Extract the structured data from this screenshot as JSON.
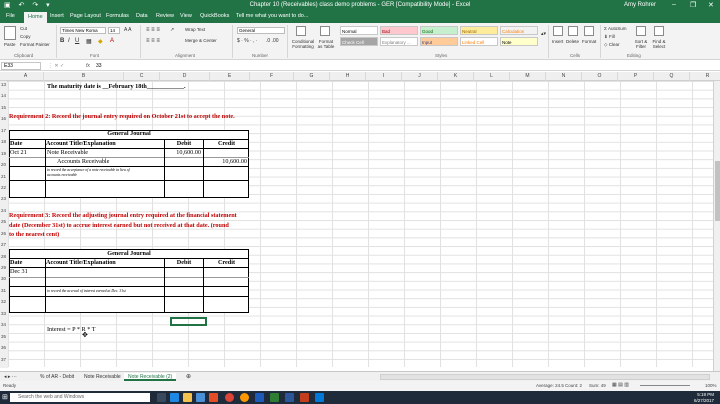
{
  "window": {
    "title": "Chapter 10 (Receivables) class demo problems - GER [Compatibility Mode] - Excel",
    "user": "Amy Rohrer"
  },
  "ribbon": {
    "tabs": [
      "File",
      "Home",
      "Insert",
      "Page Layout",
      "Formulas",
      "Data",
      "Review",
      "View",
      "QuickBooks",
      "Tell me what you want to do..."
    ],
    "active_tab": "Home",
    "font_name": "Times New Roma",
    "font_size": "14",
    "number_format": "General",
    "clipboard": {
      "cut": "Cut",
      "copy": "Copy",
      "format_painter": "Format Painter",
      "paste": "Paste"
    },
    "alignment": {
      "wrap": "Wrap Text",
      "merge": "Merge & Center"
    },
    "cond_format": "Conditional Formatting",
    "format_as_table": "Format as Table",
    "styles": [
      {
        "name": "Normal",
        "bg": "#ffffff",
        "color": "#000000"
      },
      {
        "name": "Bad",
        "bg": "#ffc7ce",
        "color": "#9c0006"
      },
      {
        "name": "Good",
        "bg": "#c6efce",
        "color": "#006100"
      },
      {
        "name": "Neutral",
        "bg": "#ffeb9c",
        "color": "#9c6500"
      },
      {
        "name": "Calculation",
        "bg": "#f2f2f2",
        "color": "#fa7d00"
      },
      {
        "name": "Check Cell",
        "bg": "#a5a5a5",
        "color": "#ffffff"
      },
      {
        "name": "Explanatory ...",
        "bg": "#ffffff",
        "color": "#7f7f7f"
      },
      {
        "name": "Input",
        "bg": "#ffcc99",
        "color": "#3f3f76"
      },
      {
        "name": "Linked Cell",
        "bg": "#ffffff",
        "color": "#fa7d00"
      },
      {
        "name": "Note",
        "bg": "#ffffcc",
        "color": "#000000"
      }
    ],
    "cells": {
      "insert": "Insert",
      "delete": "Delete",
      "format": "Format"
    },
    "editing": {
      "autosum": "AutoSum",
      "fill": "Fill",
      "clear": "Clear",
      "sort": "Sort & Filter",
      "find": "Find & Select"
    },
    "groups": {
      "clipboard": "Clipboard",
      "font": "Font",
      "alignment": "Alignment",
      "number": "Number",
      "styles": "Styles",
      "cells": "Cells",
      "editing": "Editing"
    }
  },
  "formula_bar": {
    "name_box": "E33",
    "fx": "fx",
    "content": "33"
  },
  "columns": [
    "A",
    "B",
    "C",
    "D",
    "E",
    "F",
    "G",
    "H",
    "I",
    "J",
    "K",
    "L",
    "M",
    "N",
    "O",
    "P",
    "Q",
    "R",
    "S",
    "T"
  ],
  "rows": [
    "13",
    "14",
    "15",
    "16",
    "17",
    "18",
    "19",
    "20",
    "21",
    "22",
    "23",
    "24",
    "25",
    "26",
    "27",
    "28",
    "29",
    "30",
    "31",
    "32",
    "33",
    "34",
    "35",
    "36",
    "37"
  ],
  "sheet": {
    "maturity_line": "The maturity date is __February 18th____________.",
    "req2": "Requirement 2: Record the journal entry required on October 21st to accept the note.",
    "req3_line1": "Requirement 3: Record the adjusting journal entry required at the financial statement",
    "req3_line2": "date (December 31st) to accrue interest earned but not received at that date. (round",
    "req3_line3": "to the nearest cent)",
    "journal1": {
      "title": "General Journal",
      "headers": [
        "Date",
        "Account Title/Explanation",
        "Debit",
        "Credit"
      ],
      "rows": [
        {
          "date": "Oct 21",
          "account": "Note Receivable",
          "debit": "10,600.00",
          "credit": ""
        },
        {
          "date": "",
          "account": "Accounts Receivable",
          "debit": "",
          "credit": "10,600.00"
        }
      ],
      "explanation_1": "to record the acceptance of a note receivable in lieu of",
      "explanation_2": "accounts receivable"
    },
    "journal2": {
      "title": "General Journal",
      "headers": [
        "Date",
        "Account Title/Explanation",
        "Debit",
        "Credit"
      ],
      "date": "Dec 31",
      "explanation": "to record the accrual of interest earned at Dec. 31st"
    },
    "formula_note": "Interest = P * R * T"
  },
  "sheet_tabs": [
    "% of AR - Debit",
    "Note Receivable",
    "Note Receivable (2)"
  ],
  "active_sheet": "Note Receivable (2)",
  "status": {
    "ready": "Ready",
    "average": "Average: 24.5",
    "count": "Count: 2",
    "sum": "Sum: 49",
    "zoom": "100%"
  },
  "taskbar": {
    "search": "Search the web and Windows",
    "time": "5:19 PM",
    "date": "6/27/2017"
  }
}
